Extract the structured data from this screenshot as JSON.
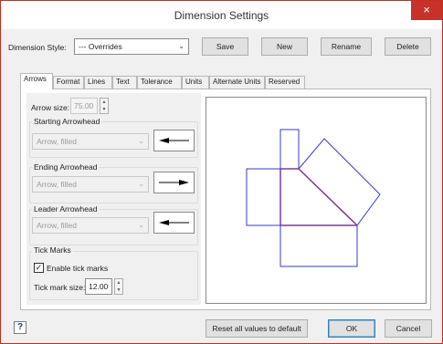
{
  "window": {
    "title": "Dimension Settings",
    "close_icon": "×"
  },
  "header": {
    "style_label": "Dimension Style:",
    "style_value": "--- Overrides",
    "save": "Save",
    "new": "New",
    "rename": "Rename",
    "delete": "Delete"
  },
  "tabs": [
    {
      "label": "Arrows"
    },
    {
      "label": "Format"
    },
    {
      "label": "Lines"
    },
    {
      "label": "Text"
    },
    {
      "label": "Tolerance"
    },
    {
      "label": "Units"
    },
    {
      "label": "Alternate Units"
    },
    {
      "label": "Reserved"
    }
  ],
  "arrows": {
    "size_label": "Arrow size:",
    "size_value": "75.00",
    "starting": {
      "title": "Starting Arrowhead",
      "value": "Arrow, filled"
    },
    "ending": {
      "title": "Ending Arrowhead",
      "value": "Arrow, filled"
    },
    "leader": {
      "title": "Leader Arrowhead",
      "value": "Arrow, filled"
    }
  },
  "ticks": {
    "title": "Tick Marks",
    "enable_label": "Enable tick marks",
    "enabled": true,
    "size_label": "Tick mark size:",
    "size_value": "12.00"
  },
  "footer": {
    "help": "?",
    "reset": "Reset all values to default",
    "ok": "OK",
    "cancel": "Cancel"
  },
  "colors": {
    "preview_blue": "#3a3ac8",
    "preview_purple": "#7a3a9a",
    "close_red": "#c7312a"
  }
}
